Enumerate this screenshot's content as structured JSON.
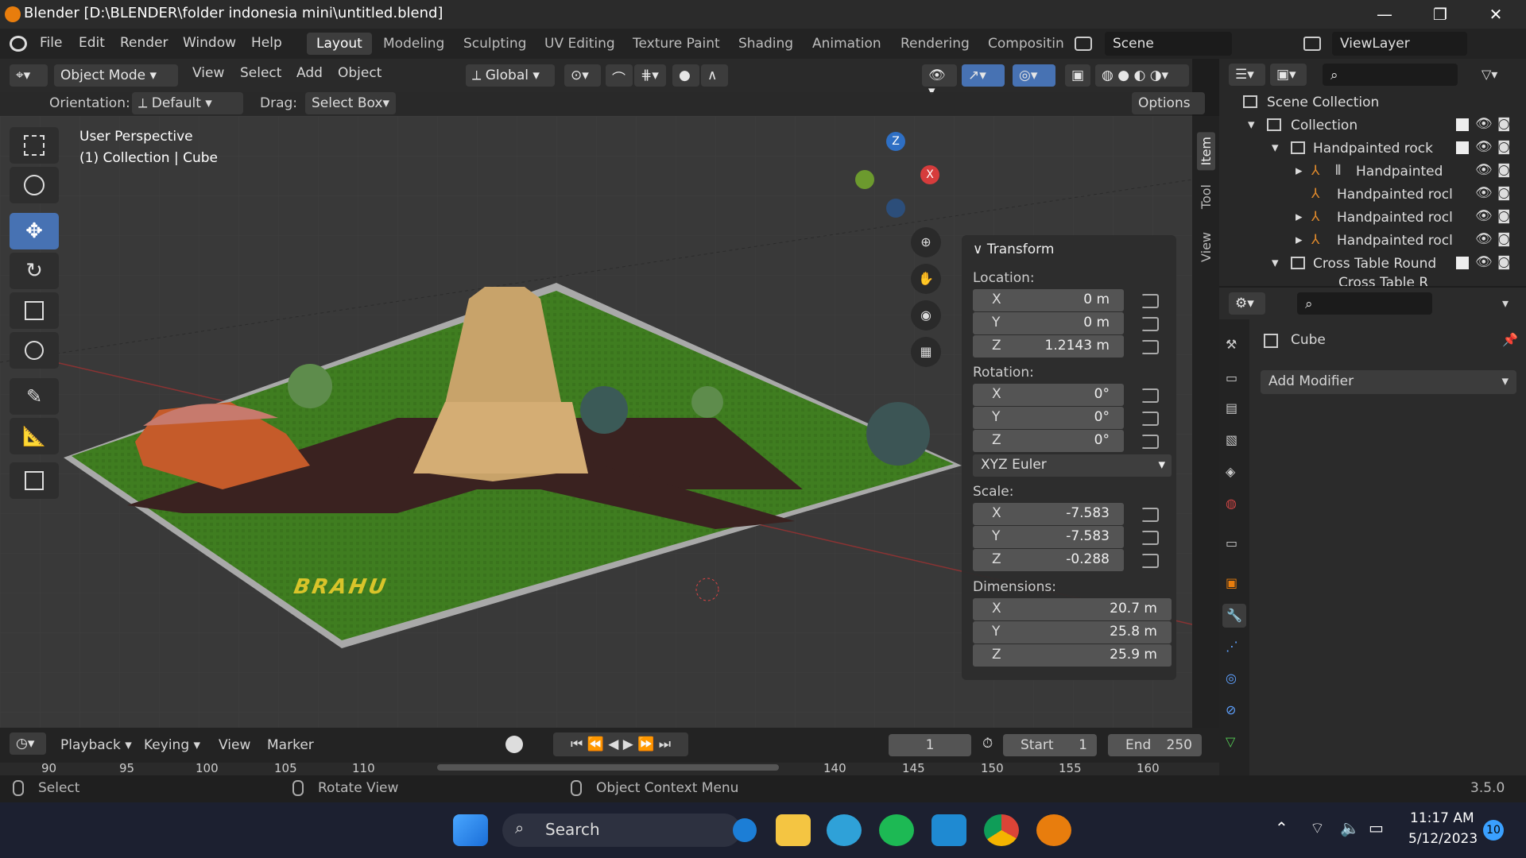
{
  "window": {
    "title": "Blender [D:\\BLENDER\\folder indonesia mini\\untitled.blend]",
    "min": "—",
    "max": "❐",
    "close": "✕"
  },
  "menu": [
    "File",
    "Edit",
    "Render",
    "Window",
    "Help"
  ],
  "workspaces": [
    "Layout",
    "Modeling",
    "Sculpting",
    "UV Editing",
    "Texture Paint",
    "Shading",
    "Animation",
    "Rendering",
    "Compositin"
  ],
  "scene": {
    "label": "Scene",
    "viewlayer": "ViewLayer"
  },
  "viewport_header": {
    "mode": "Object Mode",
    "menus": [
      "View",
      "Select",
      "Add",
      "Object"
    ],
    "transform_orientation": "Global",
    "orientation_label": "Orientation:",
    "orientation_value": "Default",
    "drag_label": "Drag:",
    "drag_value": "Select Box",
    "options": "Options"
  },
  "viewport": {
    "perspective": "User Perspective",
    "context": "(1) Collection | Cube",
    "ground_text": "BRAHU",
    "gizmo": {
      "z": "Z",
      "x": "X"
    }
  },
  "npanel": {
    "title": "Transform",
    "location_label": "Location:",
    "location": {
      "x": "0 m",
      "y": "0 m",
      "z": "1.2143 m"
    },
    "rotation_label": "Rotation:",
    "rotation": {
      "x": "0°",
      "y": "0°",
      "z": "0°"
    },
    "rotation_mode": "XYZ Euler",
    "scale_label": "Scale:",
    "scale": {
      "x": "-7.583",
      "y": "-7.583",
      "z": "-0.288"
    },
    "dimensions_label": "Dimensions:",
    "dimensions": {
      "x": "20.7 m",
      "y": "25.8 m",
      "z": "25.9 m"
    },
    "axis": {
      "x": "X",
      "y": "Y",
      "z": "Z"
    },
    "tabs": [
      "Item",
      "Tool",
      "View"
    ]
  },
  "outliner": {
    "rows": [
      {
        "label": "Scene Collection"
      },
      {
        "label": "Collection"
      },
      {
        "label": "Handpainted rock"
      },
      {
        "label": "Handpainted"
      },
      {
        "label": "Handpainted rocl"
      },
      {
        "label": "Handpainted rocl"
      },
      {
        "label": "Handpainted rocl"
      },
      {
        "label": "Cross Table Round"
      },
      {
        "label": "Cross Table R"
      }
    ]
  },
  "properties": {
    "object": "Cube",
    "add_modifier": "Add Modifier"
  },
  "timeline": {
    "menus": [
      "Playback",
      "Keying",
      "View",
      "Marker"
    ],
    "current_frame": "1",
    "start_label": "Start",
    "start": "1",
    "end_label": "End",
    "end": "250",
    "ruler": [
      "90",
      "95",
      "100",
      "105",
      "110",
      "140",
      "145",
      "150",
      "155",
      "160"
    ]
  },
  "status": {
    "select": "Select",
    "rotate": "Rotate View",
    "context": "Object Context Menu",
    "version": "3.5.0"
  },
  "taskbar": {
    "search": "Search",
    "time": "11:17 AM",
    "date": "5/12/2023",
    "notif": "10"
  },
  "colors": {
    "accent": "#4772b3",
    "grass": "#3d7a1f",
    "path": "#3a2220",
    "orange": "#e87d0d"
  }
}
